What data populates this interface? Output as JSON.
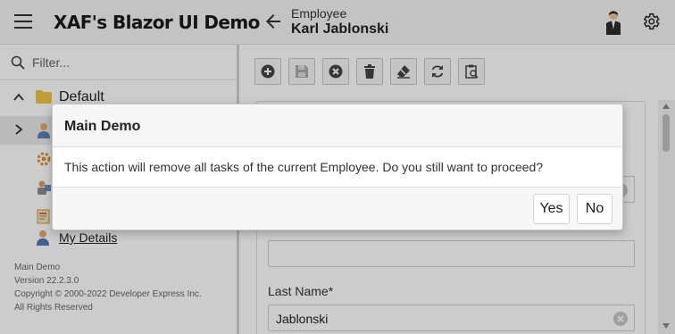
{
  "app": {
    "title": "XAF's Blazor UI Demo"
  },
  "header": {
    "caption": "Employee",
    "title": "Karl Jablonski"
  },
  "sidebar": {
    "filter_placeholder": "Filter...",
    "group_label": "Default",
    "items": [
      {
        "label": "",
        "icon": "employee-icon"
      },
      {
        "label": "",
        "icon": "gear-icon"
      },
      {
        "label": "",
        "icon": "resources-icon"
      },
      {
        "label": "",
        "icon": "note-icon"
      },
      {
        "label": "My Details",
        "icon": "user-icon"
      }
    ],
    "footer": {
      "line1": "Main Demo",
      "line2": "Version 22.2.3.0",
      "line3": "Copyright © 2000-2022 Developer Express Inc.",
      "line4": "All Rights Reserved"
    }
  },
  "toolbar": {
    "buttons": [
      "new-icon",
      "save-icon",
      "cancel-icon",
      "delete-icon",
      "clear-icon",
      "refresh-icon",
      "clipboard-icon"
    ]
  },
  "form": {
    "last_name_label": "Last Name*",
    "last_name_value": "Jablonski"
  },
  "dialog": {
    "title": "Main Demo",
    "message": "This action will remove all tasks of the current Employee. Do you still want to proceed?",
    "yes_label": "Yes",
    "no_label": "No"
  }
}
